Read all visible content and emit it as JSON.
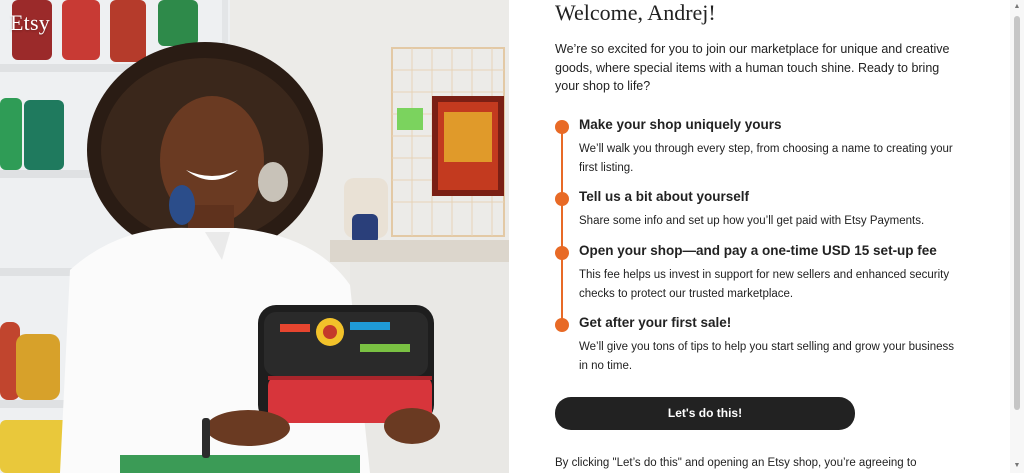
{
  "brand": {
    "logo_text": "Etsy"
  },
  "welcome": {
    "title": "Welcome, Andrej!",
    "intro": "We’re so excited for you to join our marketplace for unique and creative goods, where special items with a human touch shine. Ready to bring your shop to life?"
  },
  "steps": [
    {
      "title": "Make your shop uniquely yours",
      "description": "We’ll walk you through every step, from choosing a name to creating your first listing."
    },
    {
      "title": "Tell us a bit about yourself",
      "description": "Share some info and set up how you’ll get paid with Etsy Payments."
    },
    {
      "title": "Open your shop—and pay a one-time USD 15 set-up fee",
      "description": "This fee helps us invest in support for new sellers and enhanced security checks to protect our trusted marketplace."
    },
    {
      "title": "Get after your first sale!",
      "description": "We’ll give you tons of tips to help you start selling and grow your business in no time."
    }
  ],
  "cta": {
    "label": "Let's do this!"
  },
  "legal": {
    "text": "By clicking \"Let’s do this\" and opening an Etsy shop, you’re agreeing to"
  },
  "colors": {
    "accent": "#e86a26",
    "button": "#222222"
  },
  "scrollbar": {
    "up_icon": "arrow-up-icon",
    "down_icon": "arrow-down-icon"
  }
}
